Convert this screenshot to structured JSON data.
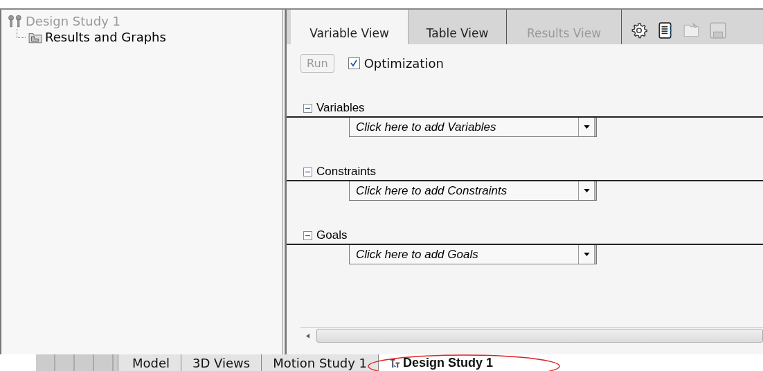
{
  "tree": {
    "title": "Design Study 1",
    "disabled": true,
    "children": [
      {
        "label": "Results and Graphs"
      }
    ]
  },
  "view_tabs": [
    {
      "label": "Variable View",
      "selected": true,
      "disabled": false
    },
    {
      "label": "Table View",
      "selected": false,
      "disabled": false
    },
    {
      "label": "Results View",
      "selected": false,
      "disabled": true
    }
  ],
  "run_button": {
    "label": "Run",
    "disabled": true
  },
  "optimization": {
    "label": "Optimization",
    "checked": true
  },
  "sections": [
    {
      "title": "Variables",
      "expanded": true,
      "placeholder": "Click here to add Variables"
    },
    {
      "title": "Constraints",
      "expanded": true,
      "placeholder": "Click here to add Constraints"
    },
    {
      "title": "Goals",
      "expanded": true,
      "placeholder": "Click here to add Goals"
    }
  ],
  "bottom_tabs": [
    {
      "label": "Model",
      "selected": false,
      "icon": false
    },
    {
      "label": "3D Views",
      "selected": false,
      "icon": false
    },
    {
      "label": "Motion Study 1",
      "selected": false,
      "icon": false
    },
    {
      "label": "Design Study 1",
      "selected": true,
      "icon": true
    }
  ]
}
